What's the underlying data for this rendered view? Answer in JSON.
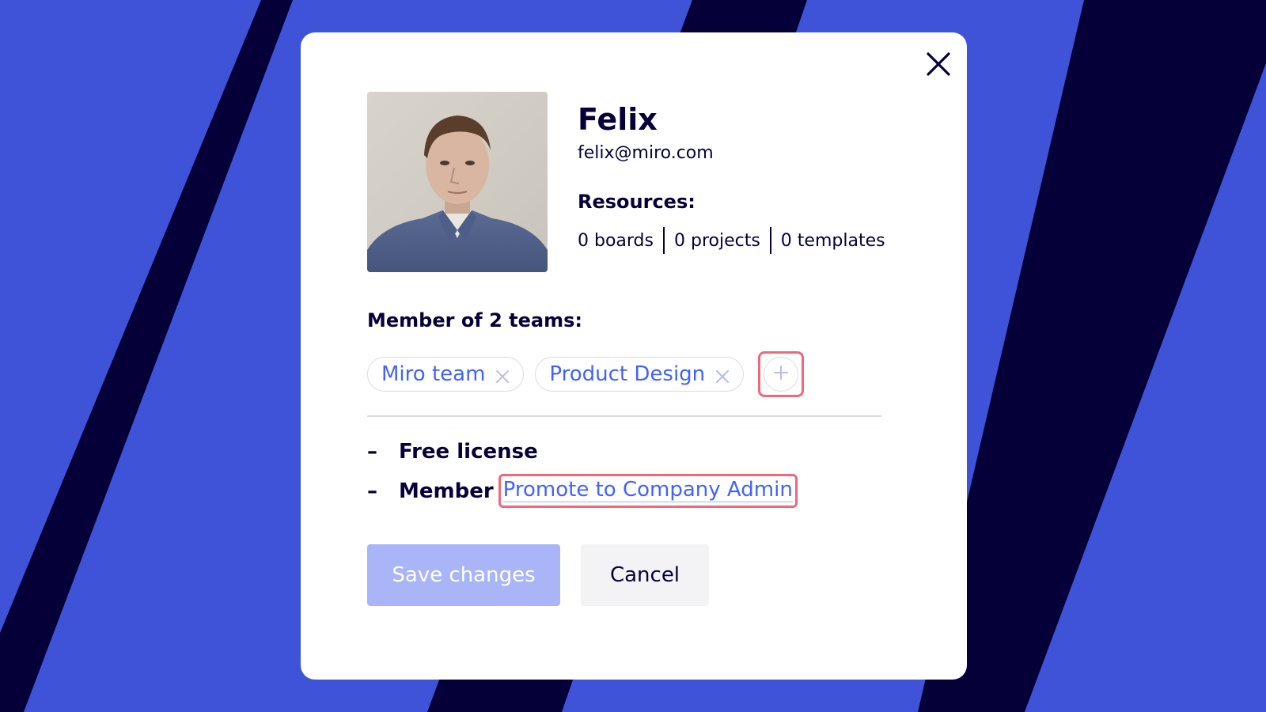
{
  "colors": {
    "background_blue": "#3f53d8",
    "background_navy": "#050038",
    "accent": "#4262ff",
    "highlight": "#f2677a",
    "save_disabled": "#aab5f8",
    "cancel_bg": "#f3f3f6"
  },
  "modal": {
    "close_icon": "close-icon",
    "user": {
      "name": "Felix",
      "email": "felix@miro.com",
      "avatar_icon": "user-avatar-photo"
    },
    "resources": {
      "title": "Resources:",
      "items": [
        "0 boards",
        "0 projects",
        "0 templates"
      ]
    },
    "teams": {
      "title": "Member of 2 teams:",
      "chips": [
        {
          "label": "Miro team",
          "remove_icon": "remove-icon"
        },
        {
          "label": "Product Design",
          "remove_icon": "remove-icon"
        }
      ],
      "add_icon": "plus-icon"
    },
    "license": {
      "dash": "–",
      "label": "Free license"
    },
    "role": {
      "dash": "–",
      "label": "Member",
      "promote_link": "Promote to Company Admin"
    },
    "buttons": {
      "save": "Save changes",
      "cancel": "Cancel"
    }
  }
}
